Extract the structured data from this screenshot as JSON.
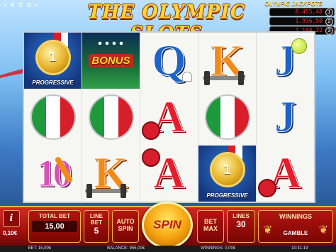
{
  "header": {
    "brand": "• X T O •",
    "logo": "THE OLYMPIC SLOTS"
  },
  "jackpots": {
    "title": "OLYMPIC JACKPOTS",
    "values": [
      "8.455,48",
      "1.936,50",
      "1.144,22"
    ],
    "badges": [
      "1",
      "2",
      "3"
    ]
  },
  "reels": [
    [
      "medal",
      "flag-italy",
      "letter-10"
    ],
    [
      "bonus",
      "flag-italy",
      "letter-K"
    ],
    [
      "letter-Q",
      "letter-A",
      "letter-A"
    ],
    [
      "letter-K",
      "flag-italy",
      "medal"
    ],
    [
      "letter-J",
      "letter-J",
      "letter-A"
    ]
  ],
  "symbols": {
    "medal_number": "1",
    "progressive_label": "PROGRESSIVE",
    "bonus_label": "BONUS",
    "letter_10": "10",
    "letter_K": "K",
    "letter_Q": "Q",
    "letter_A": "A",
    "letter_J": "J"
  },
  "controls": {
    "info_label": "i",
    "coin_value": "0,10€",
    "total_bet_label": "TOTAL BET",
    "total_bet_value": "15,00",
    "line_bet_label": "LINE BET",
    "line_bet_value": "5",
    "auto_spin_label": "AUTO SPIN",
    "spin_label": "SPIN",
    "bet_max_label": "BET MAX",
    "lines_label": "LINES",
    "lines_value": "30",
    "winnings_label": "WINNINGS",
    "gamble_label": "GAMBLE"
  },
  "status_bar": {
    "bet": "BET: 15,00€",
    "balance": "BALANCE: 955,00€",
    "winnings": "WINNINGS: 0,00€",
    "time": "10:41:19"
  },
  "colors": {
    "panel_red": "#d22a22",
    "gold": "#f2b24a",
    "italy_green": "#1e9a3c",
    "italy_red": "#d81e2a"
  }
}
